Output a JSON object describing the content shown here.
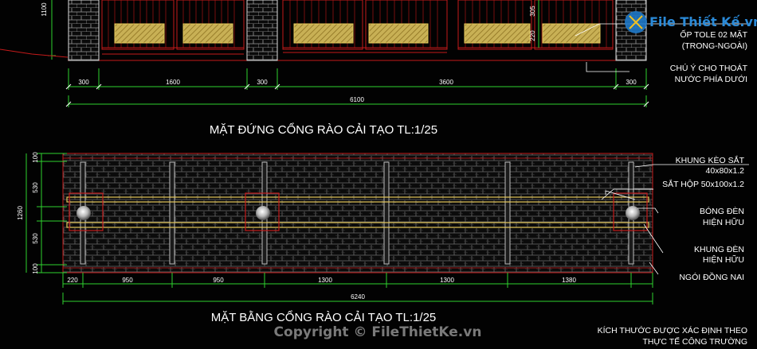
{
  "titles": {
    "elevation": "MẶT ĐỨNG CỔNG RÀO CẢI TẠO TL:1/25",
    "plan": "MẶT BẰNG CỔNG RÀO CẢI TẠO TL:1/25"
  },
  "elevation": {
    "dim_left": "1100",
    "dim_305": "305",
    "dim_220": "220",
    "dims": [
      "300",
      "1600",
      "300",
      "3600",
      "300"
    ],
    "total": "6100"
  },
  "plan": {
    "vdims": [
      "100",
      "530",
      "530",
      "100"
    ],
    "vtotal": "1260",
    "dims": [
      "220",
      "950",
      "950",
      "1300",
      "1300",
      "1380"
    ],
    "total": "6240"
  },
  "notes": {
    "op_tole": "ỐP TOLE 02 MẶT",
    "trong_ngoai": "(TRONG-NGOÀI)",
    "chu_y": "CHÚ Ý CHO THOÁT",
    "nuoc": "NƯỚC PHÍA DƯỚI",
    "khung_keo": "KHUNG KÈO SẮT",
    "khung_keo_size": "40x80x1.2",
    "sat_hop": "SẮT HỘP 50x100x1.2",
    "bong_den": "BÓNG ĐÈN",
    "hien_huu": "HIỆN HỮU",
    "khung_den": "KHUNG ĐÈN",
    "ngoi": "NGÓI ĐỒNG NAI",
    "kich_thuoc": "KÍCH THƯỚC ĐƯỢC XÁC ĐỊNH THEO",
    "thuc_te": "THỰC TẾ CÔNG TRƯỜNG"
  },
  "watermarks": {
    "brand": "File Thiết Kế.vn",
    "copyright": "Copyright © FileThietKe.vn"
  },
  "colors": {
    "background": "#020202",
    "dimension": "#2fd12f",
    "outline": "#c41a1a",
    "plate": "#e6c85a",
    "text": "#ffffff"
  }
}
